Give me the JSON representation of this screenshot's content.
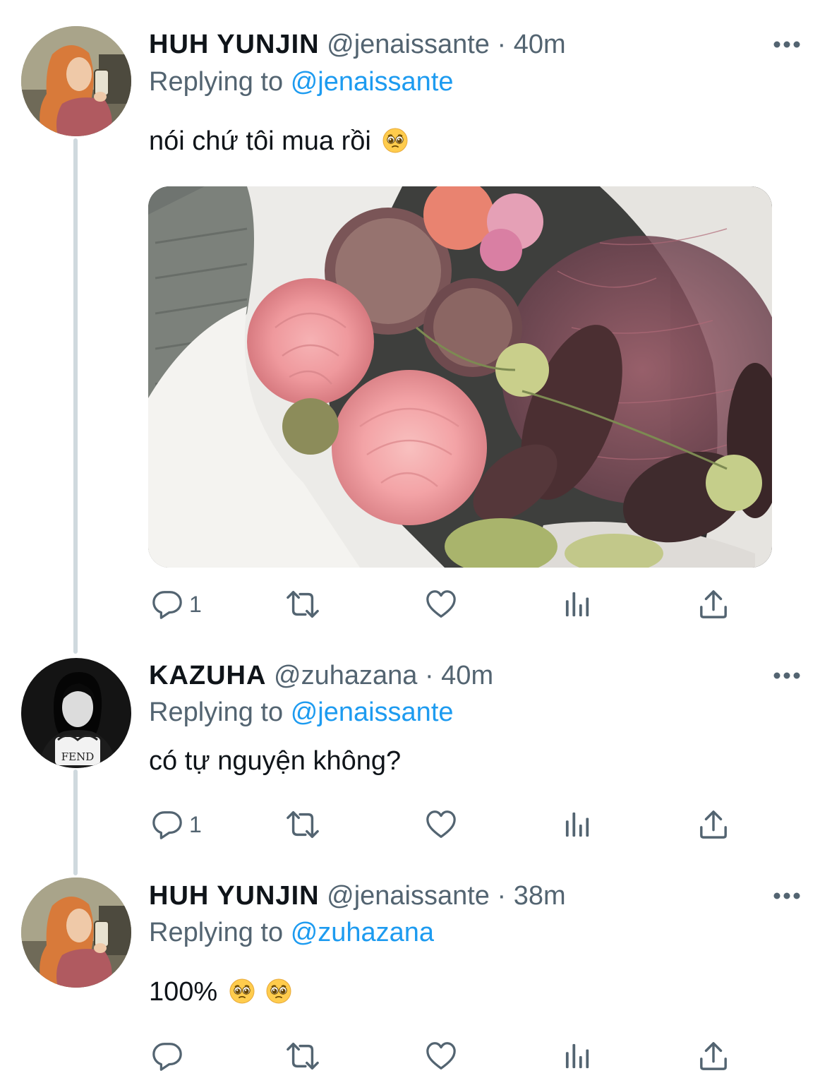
{
  "tweets": [
    {
      "name": "HUH YUNJIN",
      "handle": "@jenaissante",
      "separator": "·",
      "time": "40m",
      "replying_prefix": "Replying to",
      "replying_to": "@jenaissante",
      "text": "nói chứ tôi mua rồi",
      "emoji": "pleading-face-emoji",
      "has_image": true,
      "reply_count": "1",
      "icons": [
        "reply-icon",
        "retweet-icon",
        "like-icon",
        "views-icon",
        "share-icon"
      ]
    },
    {
      "name": "KAZUHA",
      "handle": "@zuhazana",
      "separator": "·",
      "time": "40m",
      "replying_prefix": "Replying to",
      "replying_to": "@jenaissante",
      "text": "có tự nguyện không?",
      "has_image": false,
      "reply_count": "1",
      "icons": [
        "reply-icon",
        "retweet-icon",
        "like-icon",
        "views-icon",
        "share-icon"
      ]
    },
    {
      "name": "HUH YUNJIN",
      "handle": "@jenaissante",
      "separator": "·",
      "time": "38m",
      "replying_prefix": "Replying to",
      "replying_to": "@zuhazana",
      "text": "100%",
      "emoji": "pleading-face-emoji",
      "has_image": false,
      "reply_count": "",
      "icons": [
        "reply-icon",
        "retweet-icon",
        "like-icon",
        "views-icon",
        "share-icon"
      ]
    }
  ],
  "colors": {
    "text": "#0f1419",
    "secondary": "#536471",
    "link": "#1d9bf0",
    "thread_line": "#cfd9de"
  }
}
